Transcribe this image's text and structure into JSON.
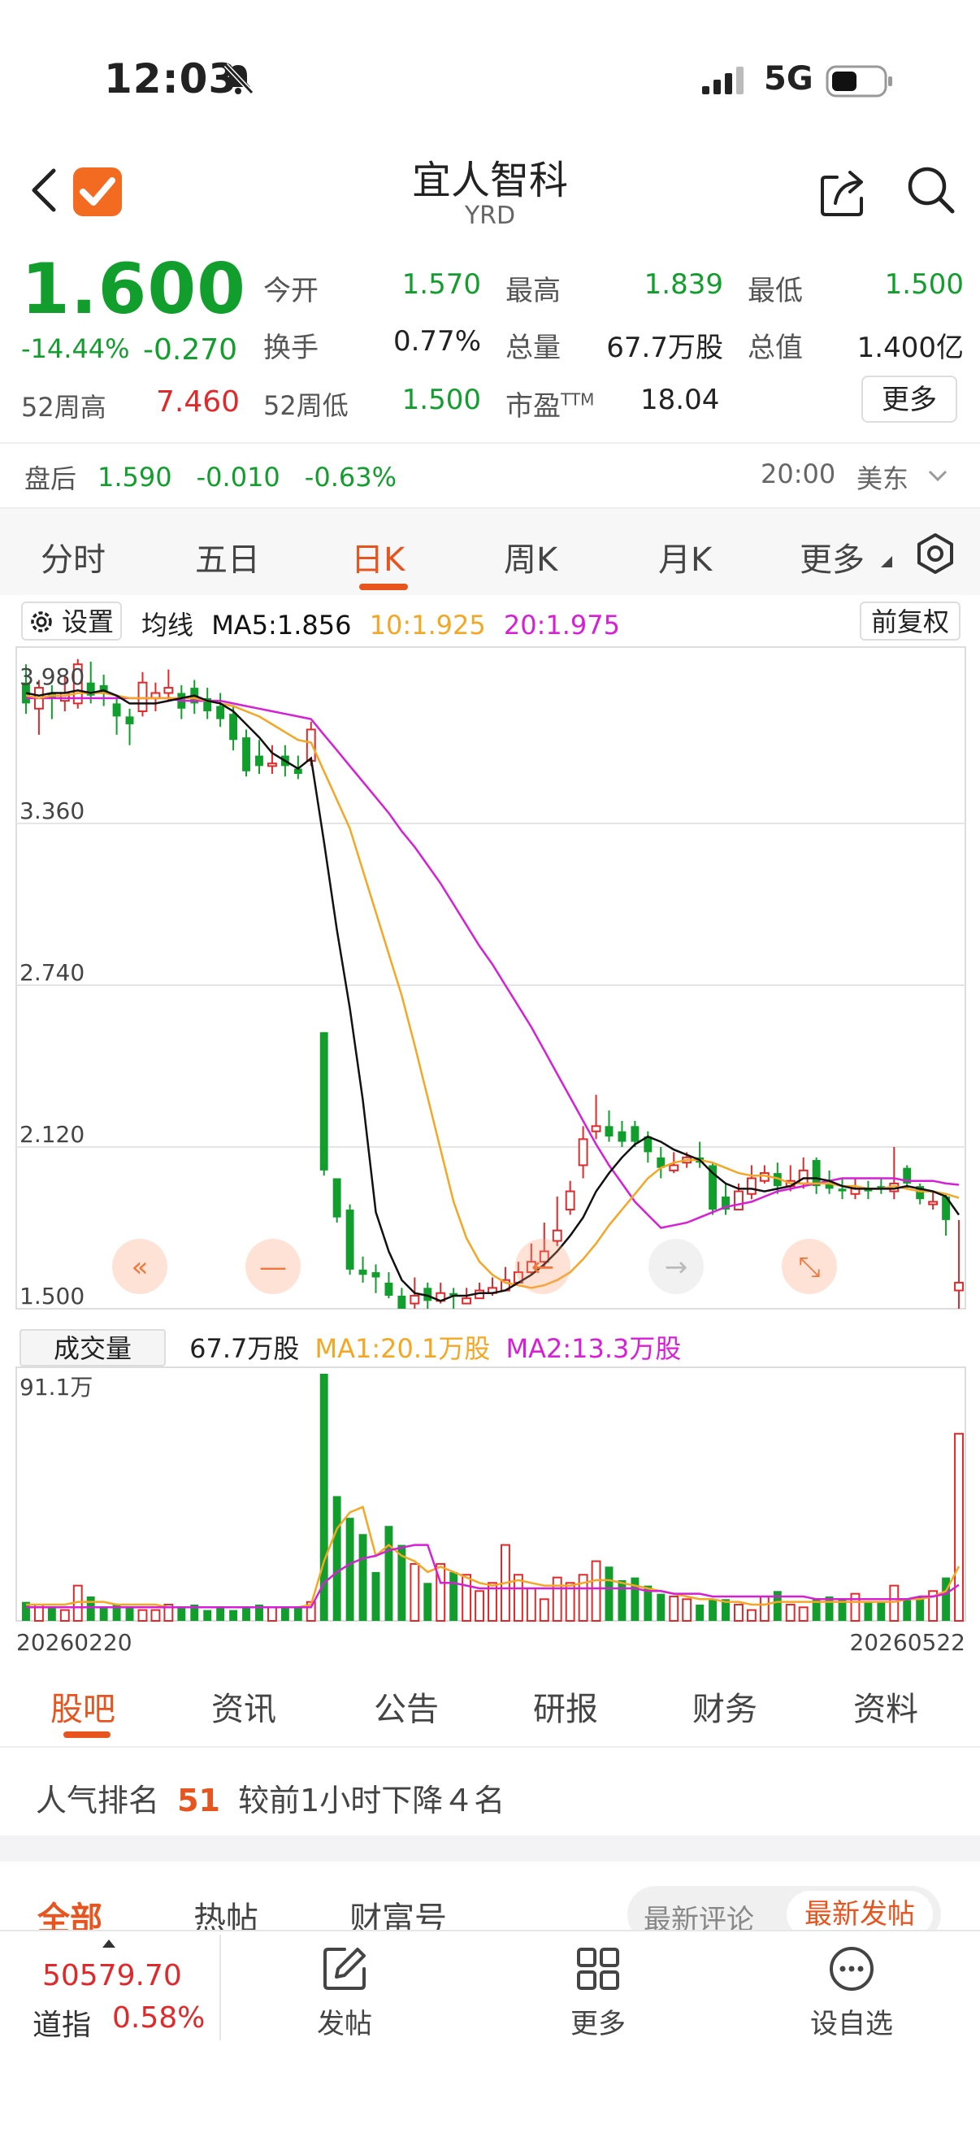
{
  "status_bar": {
    "time": "12:03",
    "network": "5G"
  },
  "header": {
    "title": "宜人智科",
    "ticker": "YRD"
  },
  "quote": {
    "price": "1.600",
    "change_pct": "-14.44%",
    "change": "-0.270",
    "open_label": "今开",
    "open": "1.570",
    "high_label": "最高",
    "high": "1.839",
    "low_label": "最低",
    "low": "1.500",
    "turnover_label": "换手",
    "turnover": "0.77%",
    "volume_label": "总量",
    "volume": "67.7万股",
    "mktcap_label": "总值",
    "mktcap": "1.400亿",
    "w52h_label": "52周高",
    "w52h": "7.460",
    "w52l_label": "52周低",
    "w52l": "1.500",
    "pe_label": "市盈",
    "pe_sup": "TTM",
    "pe": "18.04",
    "more_btn": "更多"
  },
  "after_hours": {
    "label": "盘后",
    "price": "1.590",
    "change": "-0.010",
    "pct": "-0.63%",
    "time": "20:00",
    "tz": "美东"
  },
  "chart_tabs": [
    "分时",
    "五日",
    "日K",
    "周K",
    "月K",
    "更多"
  ],
  "chart_tabs_active": 2,
  "chart_header": {
    "settings": "设置",
    "ma_title": "均线",
    "ma5": "MA5:1.856",
    "ma10": "10:1.925",
    "ma20": "20:1.975",
    "adjust": "前复权"
  },
  "colors": {
    "up": "#e0292a",
    "down": "#119e2d",
    "ma5": "#111111",
    "ma10": "#f5a623",
    "ma20": "#d61fd6",
    "accent": "#e8541e"
  },
  "volume_header": {
    "button": "成交量",
    "volume": "67.7万股",
    "ma1": "MA1:20.1万股",
    "ma2": "MA2:13.3万股"
  },
  "chart_data": {
    "type": "candlestick",
    "ylim": [
      1.5,
      3.98
    ],
    "y_ticks": [
      "3.980",
      "3.360",
      "2.740",
      "2.120",
      "1.500"
    ],
    "x_start": "20260220",
    "x_end": "20260522",
    "volume_max_label": "91.1万",
    "volume_max": 91.1,
    "candles": [
      [
        3.9,
        3.82,
        3.97,
        3.78
      ],
      [
        3.8,
        3.88,
        3.91,
        3.7
      ],
      [
        3.86,
        3.84,
        3.89,
        3.76
      ],
      [
        3.83,
        3.86,
        3.93,
        3.79
      ],
      [
        3.82,
        3.97,
        3.99,
        3.8
      ],
      [
        3.9,
        3.85,
        3.98,
        3.82
      ],
      [
        3.89,
        3.86,
        3.93,
        3.81
      ],
      [
        3.82,
        3.77,
        3.85,
        3.7
      ],
      [
        3.77,
        3.74,
        3.8,
        3.66
      ],
      [
        3.79,
        3.9,
        3.94,
        3.77
      ],
      [
        3.84,
        3.86,
        3.9,
        3.79
      ],
      [
        3.86,
        3.88,
        3.95,
        3.83
      ],
      [
        3.86,
        3.8,
        3.89,
        3.76
      ],
      [
        3.88,
        3.82,
        3.91,
        3.78
      ],
      [
        3.84,
        3.79,
        3.88,
        3.76
      ],
      [
        3.81,
        3.76,
        3.86,
        3.73
      ],
      [
        3.78,
        3.68,
        3.81,
        3.64
      ],
      [
        3.69,
        3.56,
        3.72,
        3.54
      ],
      [
        3.62,
        3.58,
        3.68,
        3.55
      ],
      [
        3.58,
        3.59,
        3.66,
        3.55
      ],
      [
        3.62,
        3.58,
        3.66,
        3.54
      ],
      [
        3.57,
        3.55,
        3.62,
        3.53
      ],
      [
        3.6,
        3.72,
        3.75,
        3.58
      ],
      [
        2.56,
        2.03,
        2.56,
        2.01
      ],
      [
        2.0,
        1.85,
        2.0,
        1.83
      ],
      [
        1.88,
        1.65,
        1.9,
        1.63
      ],
      [
        1.65,
        1.63,
        1.7,
        1.6
      ],
      [
        1.64,
        1.62,
        1.67,
        1.56
      ],
      [
        1.6,
        1.55,
        1.64,
        1.54
      ],
      [
        1.55,
        1.5,
        1.58,
        1.5
      ],
      [
        1.52,
        1.55,
        1.62,
        1.5
      ],
      [
        1.58,
        1.53,
        1.6,
        1.5
      ],
      [
        1.53,
        1.56,
        1.6,
        1.52
      ],
      [
        1.56,
        1.55,
        1.58,
        1.5
      ],
      [
        1.52,
        1.54,
        1.58,
        1.52
      ],
      [
        1.54,
        1.57,
        1.6,
        1.55
      ],
      [
        1.56,
        1.58,
        1.62,
        1.55
      ],
      [
        1.57,
        1.61,
        1.66,
        1.57
      ],
      [
        1.6,
        1.64,
        1.68,
        1.6
      ],
      [
        1.64,
        1.68,
        1.75,
        1.63
      ],
      [
        1.68,
        1.72,
        1.83,
        1.66
      ],
      [
        1.76,
        1.8,
        1.93,
        1.74
      ],
      [
        1.88,
        1.95,
        1.99,
        1.86
      ],
      [
        2.05,
        2.15,
        2.2,
        2.0
      ],
      [
        2.18,
        2.2,
        2.32,
        2.15
      ],
      [
        2.2,
        2.16,
        2.26,
        2.14
      ],
      [
        2.18,
        2.14,
        2.22,
        2.12
      ],
      [
        2.2,
        2.14,
        2.22,
        2.12
      ],
      [
        2.16,
        2.1,
        2.18,
        2.06
      ],
      [
        2.08,
        2.04,
        2.12,
        2.0
      ],
      [
        2.03,
        2.05,
        2.1,
        2.02
      ],
      [
        2.06,
        2.08,
        2.1,
        2.04
      ],
      [
        2.08,
        2.06,
        2.14,
        2.04
      ],
      [
        2.05,
        1.88,
        2.06,
        1.86
      ],
      [
        1.93,
        1.88,
        1.98,
        1.86
      ],
      [
        1.88,
        1.95,
        1.98,
        1.88
      ],
      [
        1.94,
        2.0,
        2.05,
        1.92
      ],
      [
        1.99,
        2.02,
        2.05,
        1.98
      ],
      [
        2.02,
        1.97,
        2.06,
        1.94
      ],
      [
        1.97,
        1.99,
        2.05,
        1.95
      ],
      [
        1.98,
        2.03,
        2.08,
        1.96
      ],
      [
        2.07,
        1.97,
        2.08,
        1.94
      ],
      [
        1.98,
        1.96,
        2.03,
        1.94
      ],
      [
        1.96,
        1.95,
        2.0,
        1.92
      ],
      [
        1.94,
        1.96,
        2.0,
        1.92
      ],
      [
        1.96,
        1.95,
        1.99,
        1.92
      ],
      [
        1.97,
        1.96,
        2.0,
        1.94
      ],
      [
        1.95,
        1.98,
        2.12,
        1.92
      ],
      [
        2.04,
        1.98,
        2.05,
        1.96
      ],
      [
        1.97,
        1.92,
        1.98,
        1.9
      ],
      [
        1.9,
        1.91,
        1.95,
        1.88
      ],
      [
        1.93,
        1.84,
        1.94,
        1.78
      ],
      [
        1.57,
        1.6,
        1.84,
        1.5
      ]
    ],
    "ma5": [
      3.86,
      3.85,
      3.86,
      3.86,
      3.87,
      3.86,
      3.87,
      3.85,
      3.82,
      3.82,
      3.82,
      3.83,
      3.84,
      3.85,
      3.83,
      3.82,
      3.79,
      3.74,
      3.69,
      3.63,
      3.6,
      3.57,
      3.61,
      3.29,
      2.95,
      2.65,
      2.3,
      1.87,
      1.72,
      1.61,
      1.56,
      1.55,
      1.53,
      1.55,
      1.55,
      1.56,
      1.56,
      1.57,
      1.6,
      1.63,
      1.67,
      1.72,
      1.78,
      1.85,
      1.95,
      2.02,
      2.08,
      2.13,
      2.16,
      2.14,
      2.11,
      2.09,
      2.07,
      2.02,
      1.98,
      1.96,
      1.96,
      1.95,
      1.96,
      1.97,
      2.0,
      2.0,
      1.99,
      1.97,
      1.96,
      1.96,
      1.96,
      1.96,
      1.97,
      1.96,
      1.95,
      1.93,
      1.86
    ],
    "ma10": [
      3.85,
      3.84,
      3.85,
      3.85,
      3.86,
      3.86,
      3.86,
      3.85,
      3.84,
      3.84,
      3.84,
      3.84,
      3.84,
      3.84,
      3.83,
      3.82,
      3.81,
      3.79,
      3.77,
      3.74,
      3.71,
      3.68,
      3.67,
      3.56,
      3.45,
      3.34,
      3.18,
      3.02,
      2.86,
      2.7,
      2.51,
      2.31,
      2.11,
      1.91,
      1.77,
      1.68,
      1.63,
      1.6,
      1.59,
      1.58,
      1.59,
      1.61,
      1.64,
      1.69,
      1.75,
      1.82,
      1.88,
      1.94,
      2.0,
      2.04,
      2.06,
      2.07,
      2.07,
      2.06,
      2.04,
      2.02,
      2.01,
      2.01,
      2.0,
      1.98,
      1.98,
      1.98,
      1.98,
      1.97,
      1.97,
      1.96,
      1.96,
      1.97,
      1.96,
      1.95,
      1.95,
      1.94,
      1.925
    ],
    "ma20": [
      3.84,
      3.84,
      3.84,
      3.84,
      3.84,
      3.84,
      3.84,
      3.84,
      3.84,
      3.84,
      3.84,
      3.84,
      3.83,
      3.83,
      3.83,
      3.83,
      3.82,
      3.81,
      3.8,
      3.79,
      3.78,
      3.77,
      3.76,
      3.7,
      3.64,
      3.58,
      3.52,
      3.46,
      3.4,
      3.33,
      3.27,
      3.2,
      3.13,
      3.05,
      2.97,
      2.89,
      2.82,
      2.74,
      2.66,
      2.58,
      2.49,
      2.4,
      2.31,
      2.22,
      2.13,
      2.05,
      1.98,
      1.91,
      1.86,
      1.81,
      1.82,
      1.83,
      1.85,
      1.87,
      1.89,
      1.9,
      1.91,
      1.93,
      1.95,
      1.96,
      1.97,
      1.98,
      1.99,
      2.0,
      2.0,
      2.0,
      2.0,
      2.0,
      1.99,
      1.99,
      1.99,
      1.98,
      1.975
    ],
    "volume": [
      7,
      6,
      5,
      4,
      13,
      9,
      5,
      6,
      5,
      4,
      4,
      6,
      5,
      6,
      4,
      5,
      4,
      5,
      6,
      5,
      5,
      5,
      7,
      91.1,
      46,
      38,
      32,
      18,
      35,
      28,
      21,
      14,
      21,
      18,
      17,
      11,
      14,
      28,
      17,
      12,
      8,
      16,
      14,
      17,
      22,
      20,
      15,
      16,
      13,
      10,
      9,
      8,
      6,
      8,
      8,
      6,
      4,
      9,
      11,
      6,
      5,
      8,
      9,
      8,
      10,
      7,
      7,
      13,
      8,
      9,
      11,
      16,
      69
    ]
  },
  "vol_ma1": [
    6,
    6,
    6,
    6,
    7,
    7,
    7,
    6,
    6,
    6,
    6,
    5,
    5,
    5,
    5,
    5,
    5,
    5,
    5,
    5,
    5,
    5,
    6,
    22,
    34,
    40,
    42,
    24,
    28,
    24,
    22,
    18,
    20,
    18,
    16,
    14,
    13,
    14,
    15,
    14,
    13,
    13,
    13,
    14,
    15,
    15,
    14,
    13,
    12,
    11,
    10,
    9,
    8,
    8,
    7,
    7,
    6,
    6,
    7,
    7,
    7,
    7,
    7,
    7,
    7,
    7,
    7,
    7,
    8,
    8,
    9,
    11,
    20.1
  ],
  "vol_ma2": [
    5,
    5,
    5,
    5,
    5,
    5,
    5,
    5,
    5,
    5,
    5,
    5,
    5,
    5,
    5,
    5,
    5,
    5,
    5,
    5,
    5,
    5,
    5,
    14,
    18,
    21,
    23,
    24,
    26,
    27,
    28,
    28,
    14,
    14,
    13,
    12,
    12,
    12,
    12,
    12,
    12,
    12,
    12,
    12,
    12,
    12,
    12,
    12,
    11,
    11,
    10,
    10,
    10,
    9,
    9,
    9,
    9,
    9,
    9,
    9,
    9,
    8,
    8,
    8,
    8,
    8,
    8,
    8,
    8,
    9,
    9,
    10,
    13.3
  ],
  "bottom_tabs": [
    "股吧",
    "资讯",
    "公告",
    "研报",
    "财务",
    "资料"
  ],
  "bottom_tabs_active": 0,
  "popularity": {
    "label": "人气排名",
    "rank": "51",
    "note": "较前1小时下降４名"
  },
  "feed_tabs": [
    "全部",
    "热帖",
    "财富号"
  ],
  "feed_tabs_active": 0,
  "sort_options": [
    "最新评论",
    "最新发帖"
  ],
  "sort_active": 1,
  "bottom_bar": {
    "index_value": "50579.70",
    "index_name": "道指",
    "index_pct": "0.58%",
    "post": "发帖",
    "more": "更多",
    "watch": "设自选"
  }
}
